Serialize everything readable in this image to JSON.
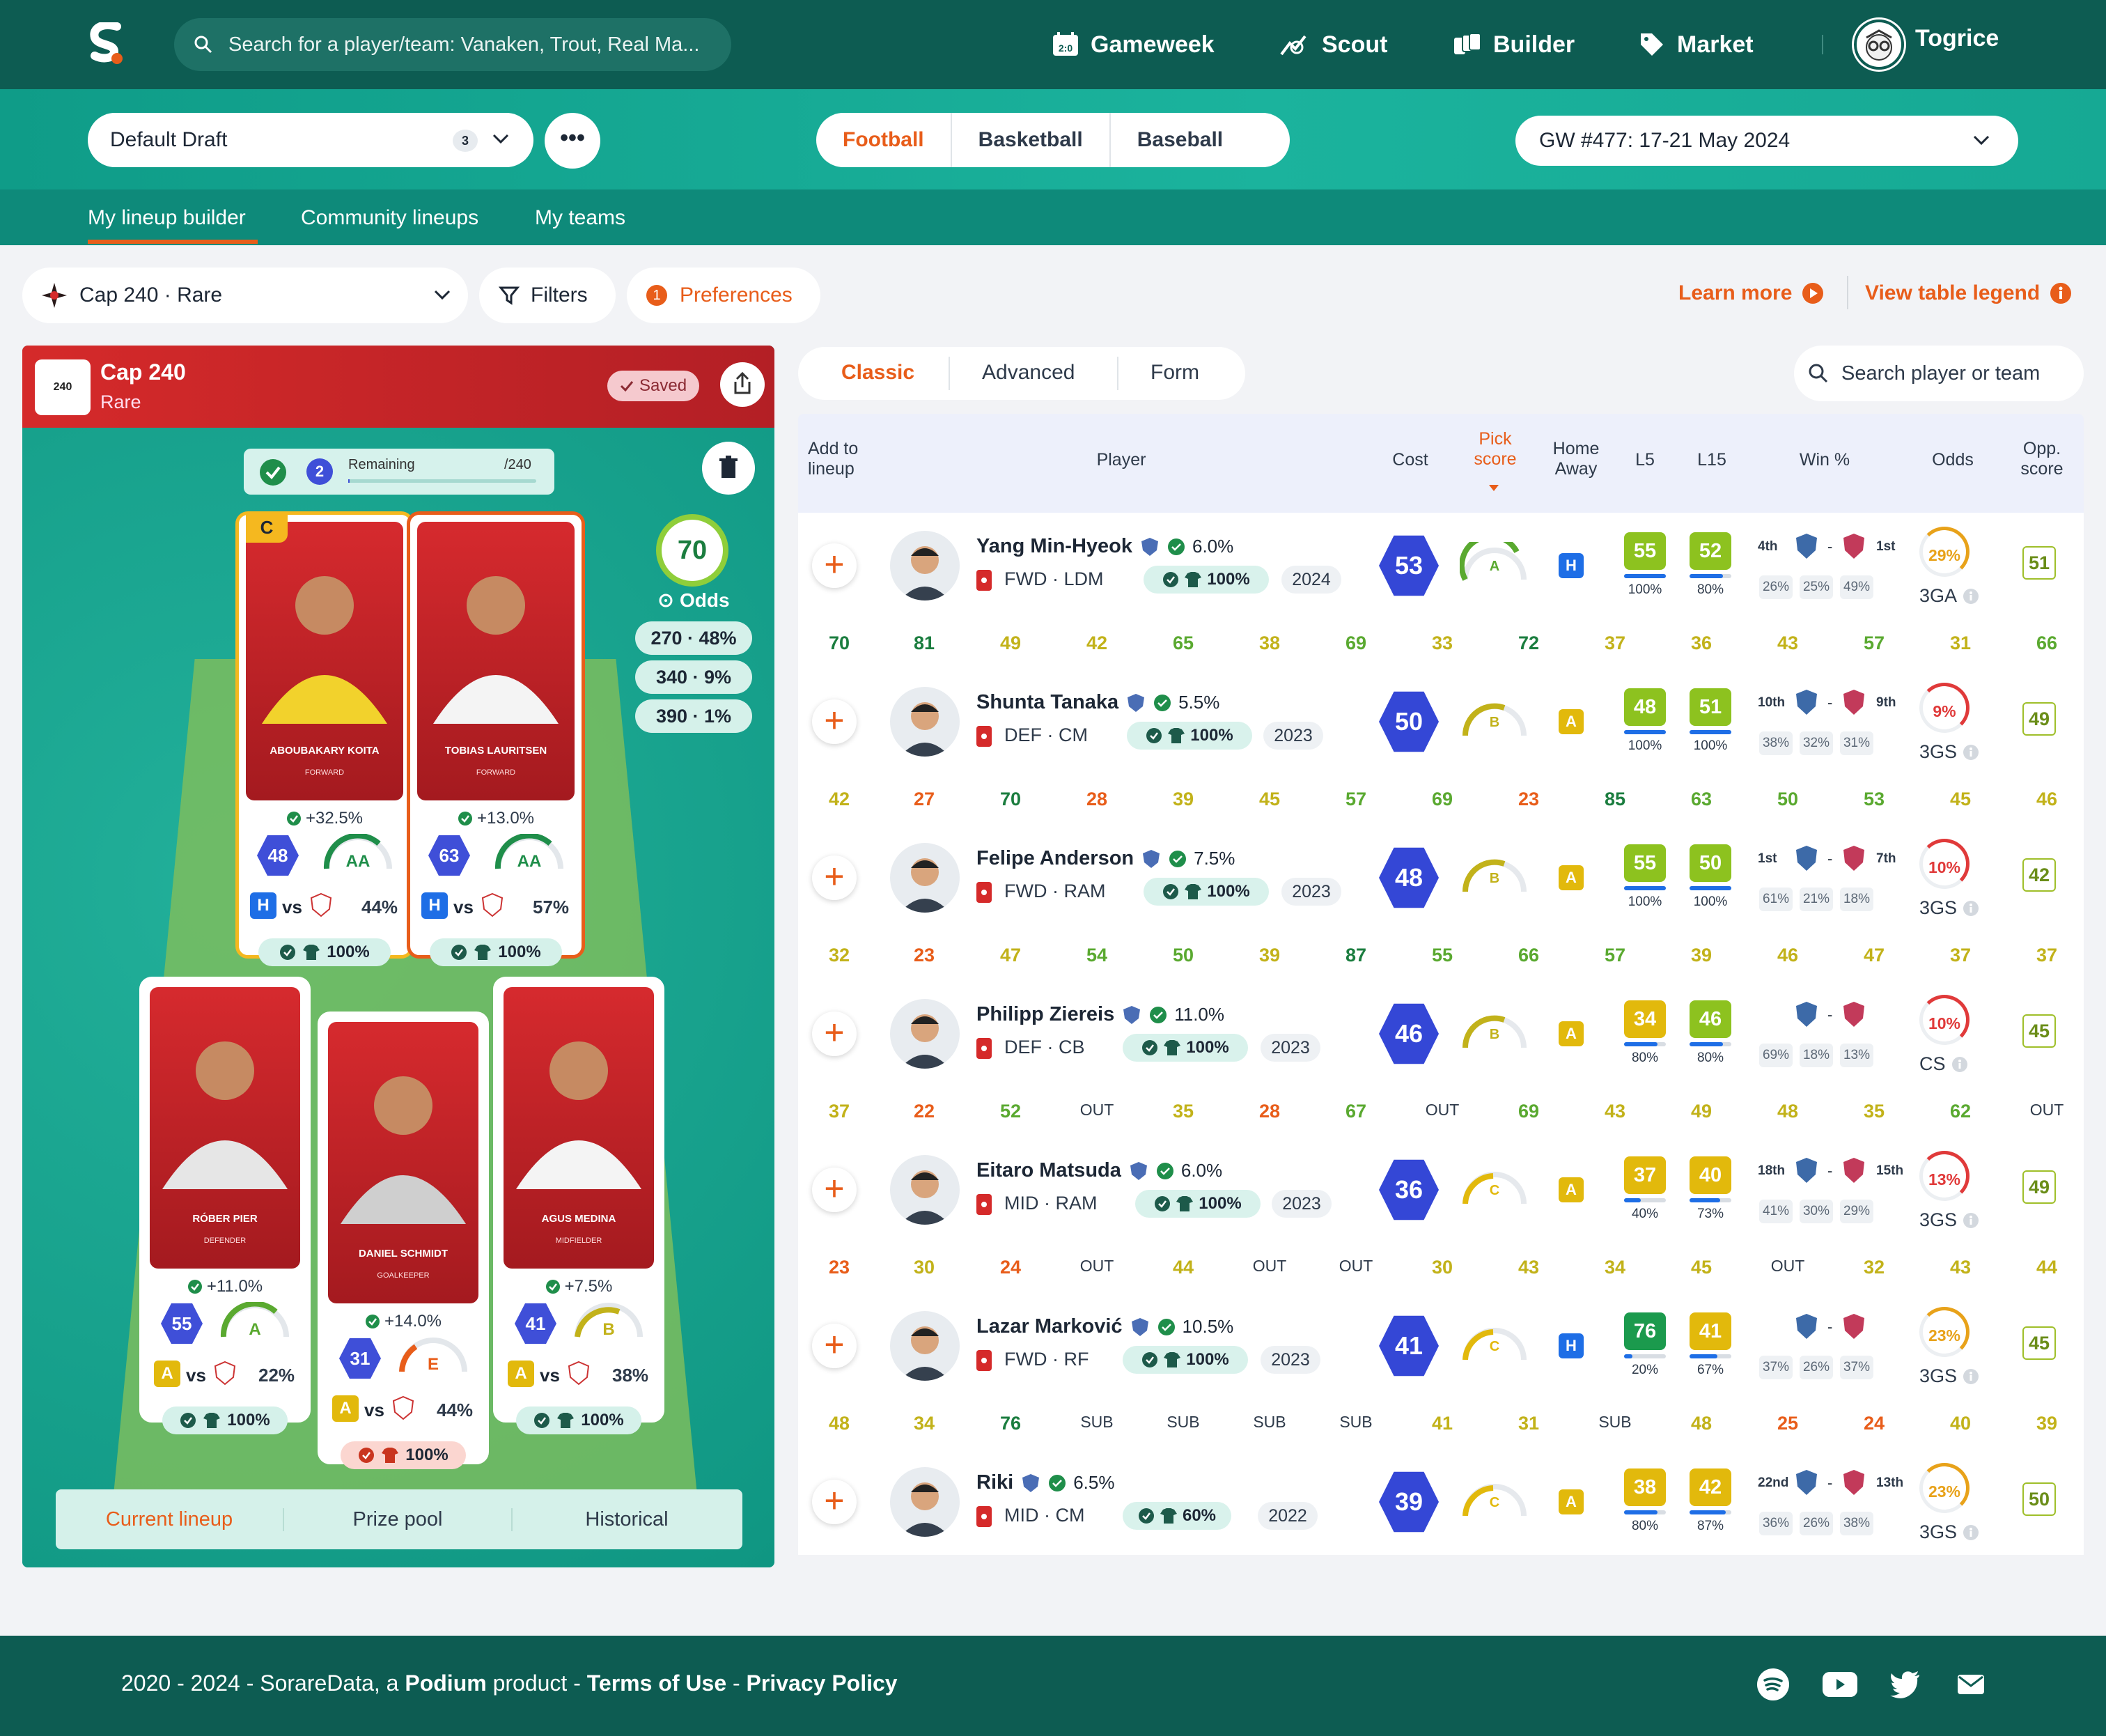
{
  "nav": {
    "search_placeholder": "Search for a player/team: Vanaken, Trout, Real Ma...",
    "items": [
      "Gameweek",
      "Scout",
      "Builder",
      "Market"
    ],
    "user": "Togrice"
  },
  "draft": {
    "name": "Default Draft",
    "count": "3",
    "more": "•••"
  },
  "sports": [
    "Football",
    "Basketball",
    "Baseball"
  ],
  "gameweek": "GW #477: 17-21 May 2024",
  "subtabs": [
    "My lineup builder",
    "Community lineups",
    "My teams"
  ],
  "filters": {
    "competition": "Cap 240 · Rare",
    "filters": "Filters",
    "pref_count": "1",
    "preferences": "Preferences",
    "learn_more": "Learn more",
    "legend": "View table legend"
  },
  "panel": {
    "logo": "240",
    "title": "Cap 240",
    "subtitle": "Rare",
    "saved": "Saved",
    "remaining_count": "2",
    "remaining_label": "Remaining",
    "remaining_total": "/240",
    "score": "70",
    "odds_label": "Odds",
    "odds": [
      "270 · 48%",
      "340 · 9%",
      "390 · 1%"
    ],
    "tabs": [
      "Current lineup",
      "Prize pool",
      "Historical"
    ]
  },
  "cards": [
    {
      "name": "ABOUBAKARY KOITA",
      "role": "FORWARD",
      "captain": "C",
      "boost": "+32.5%",
      "score": "48",
      "grade": "AA",
      "ha": "H",
      "vs": "vs",
      "pct": "44%",
      "own": "100%"
    },
    {
      "name": "TOBIAS LAURITSEN",
      "role": "FORWARD",
      "boost": "+13.0%",
      "score": "63",
      "grade": "AA",
      "ha": "H",
      "vs": "vs",
      "pct": "57%",
      "own": "100%"
    },
    {
      "name": "RÓBER PIER",
      "role": "DEFENDER",
      "boost": "+11.0%",
      "score": "55",
      "grade": "A",
      "ha": "A",
      "vs": "vs",
      "pct": "22%",
      "own": "100%"
    },
    {
      "name": "DANIEL SCHMIDT",
      "role": "GOALKEEPER",
      "boost": "+14.0%",
      "score": "31",
      "grade": "E",
      "ha": "A",
      "vs": "vs",
      "pct": "44%",
      "own": "100%"
    },
    {
      "name": "AGUS MEDINA",
      "role": "MIDFIELDER",
      "boost": "+7.5%",
      "score": "41",
      "grade": "B",
      "ha": "A",
      "vs": "vs",
      "pct": "38%",
      "own": "100%"
    }
  ],
  "table": {
    "view_tabs": [
      "Classic",
      "Advanced",
      "Form"
    ],
    "search_placeholder": "Search player or team",
    "headers": [
      "Add to lineup",
      "Player",
      "Cost",
      "Pick score",
      "Home Away",
      "L5",
      "L15",
      "Win %",
      "Odds",
      "Opp. score"
    ],
    "rows": [
      {
        "name": "Yang Min-Hyeok",
        "pick": "6.0%",
        "pos": "FWD · LDM",
        "own": "100%",
        "year": "2024",
        "cost": "53",
        "grade": "A",
        "ha": "H",
        "l5": "55",
        "l15": "52",
        "l5p": "100%",
        "l15p": "80%",
        "rank1": "4th",
        "rank2": "1st",
        "w": [
          "26%",
          "25%",
          "49%"
        ],
        "odds": "29%",
        "odds_lbl": "3GA",
        "opp": "51",
        "l5c": "#8dc21f",
        "l15c": "#8dc21f"
      },
      {
        "name": "Shunta Tanaka",
        "pick": "5.5%",
        "pos": "DEF · CM",
        "own": "100%",
        "year": "2023",
        "cost": "50",
        "grade": "B",
        "ha": "A",
        "l5": "48",
        "l15": "51",
        "l5p": "100%",
        "l15p": "100%",
        "rank1": "10th",
        "rank2": "9th",
        "w": [
          "38%",
          "32%",
          "31%"
        ],
        "odds": "9%",
        "odds_lbl": "3GS",
        "opp": "49",
        "l5c": "#8dc21f",
        "l15c": "#8dc21f"
      },
      {
        "name": "Felipe Anderson",
        "pick": "7.5%",
        "pos": "FWD · RAM",
        "own": "100%",
        "year": "2023",
        "cost": "48",
        "grade": "B",
        "ha": "A",
        "l5": "55",
        "l15": "50",
        "l5p": "100%",
        "l15p": "100%",
        "rank1": "1st",
        "rank2": "7th",
        "w": [
          "61%",
          "21%",
          "18%"
        ],
        "odds": "10%",
        "odds_lbl": "3GS",
        "opp": "42",
        "l5c": "#8dc21f",
        "l15c": "#8dc21f"
      },
      {
        "name": "Philipp Ziereis",
        "pick": "11.0%",
        "pos": "DEF · CB",
        "own": "100%",
        "year": "2023",
        "cost": "46",
        "grade": "B",
        "ha": "A",
        "l5": "34",
        "l15": "46",
        "l5p": "80%",
        "l15p": "80%",
        "rank1": "",
        "rank2": "",
        "w": [
          "69%",
          "18%",
          "13%"
        ],
        "odds": "10%",
        "odds_lbl": "CS",
        "opp": "45",
        "l5c": "#e2b90c",
        "l15c": "#8dc21f"
      },
      {
        "name": "Eitaro Matsuda",
        "pick": "6.0%",
        "pos": "MID · RAM",
        "own": "100%",
        "year": "2023",
        "cost": "36",
        "grade": "C",
        "ha": "A",
        "l5": "37",
        "l15": "40",
        "l5p": "40%",
        "l15p": "73%",
        "rank1": "18th",
        "rank2": "15th",
        "w": [
          "41%",
          "30%",
          "29%"
        ],
        "odds": "13%",
        "odds_lbl": "3GS",
        "opp": "49",
        "l5c": "#e2b90c",
        "l15c": "#e2b90c"
      },
      {
        "name": "Lazar Marković",
        "pick": "10.5%",
        "pos": "FWD · RF",
        "own": "100%",
        "year": "2023",
        "cost": "41",
        "grade": "C",
        "ha": "H",
        "l5": "76",
        "l15": "41",
        "l5p": "20%",
        "l15p": "67%",
        "rank1": "",
        "rank2": "",
        "w": [
          "37%",
          "26%",
          "37%"
        ],
        "odds": "23%",
        "odds_lbl": "3GS",
        "opp": "45",
        "l5c": "#1b9a4d",
        "l15c": "#e2b90c"
      },
      {
        "name": "Riki",
        "pick": "6.5%",
        "pos": "MID · CM",
        "own": "60%",
        "year": "2022",
        "cost": "39",
        "grade": "C",
        "ha": "A",
        "l5": "38",
        "l15": "42",
        "l5p": "80%",
        "l15p": "87%",
        "rank1": "22nd",
        "rank2": "13th",
        "w": [
          "36%",
          "26%",
          "38%"
        ],
        "odds": "23%",
        "odds_lbl": "3GS",
        "opp": "50",
        "l5c": "#e2b90c",
        "l15c": "#e2b90c"
      }
    ],
    "history": [
      [
        "70",
        "81",
        "49",
        "42",
        "65",
        "38",
        "69",
        "33",
        "72",
        "37",
        "36",
        "43",
        "57",
        "31",
        "66"
      ],
      [
        "42",
        "27",
        "70",
        "28",
        "39",
        "45",
        "57",
        "69",
        "23",
        "85",
        "63",
        "50",
        "53",
        "45",
        "46"
      ],
      [
        "32",
        "23",
        "47",
        "54",
        "50",
        "39",
        "87",
        "55",
        "66",
        "57",
        "39",
        "46",
        "47",
        "37",
        "37"
      ],
      [
        "37",
        "22",
        "52",
        "OUT",
        "35",
        "28",
        "67",
        "OUT",
        "69",
        "43",
        "49",
        "48",
        "35",
        "62",
        "OUT"
      ],
      [
        "23",
        "30",
        "24",
        "OUT",
        "44",
        "OUT",
        "OUT",
        "30",
        "43",
        "34",
        "45",
        "OUT",
        "32",
        "43",
        "44"
      ],
      [
        "48",
        "34",
        "76",
        "SUB",
        "SUB",
        "SUB",
        "SUB",
        "41",
        "31",
        "SUB",
        "48",
        "25",
        "24",
        "40",
        "39"
      ]
    ]
  },
  "footer": {
    "years": "2020 - 2024 - SorareData, a ",
    "podium": "Podium",
    "product": " product - ",
    "terms": "Terms of Use",
    "dash": " - ",
    "privacy": "Privacy Policy"
  }
}
